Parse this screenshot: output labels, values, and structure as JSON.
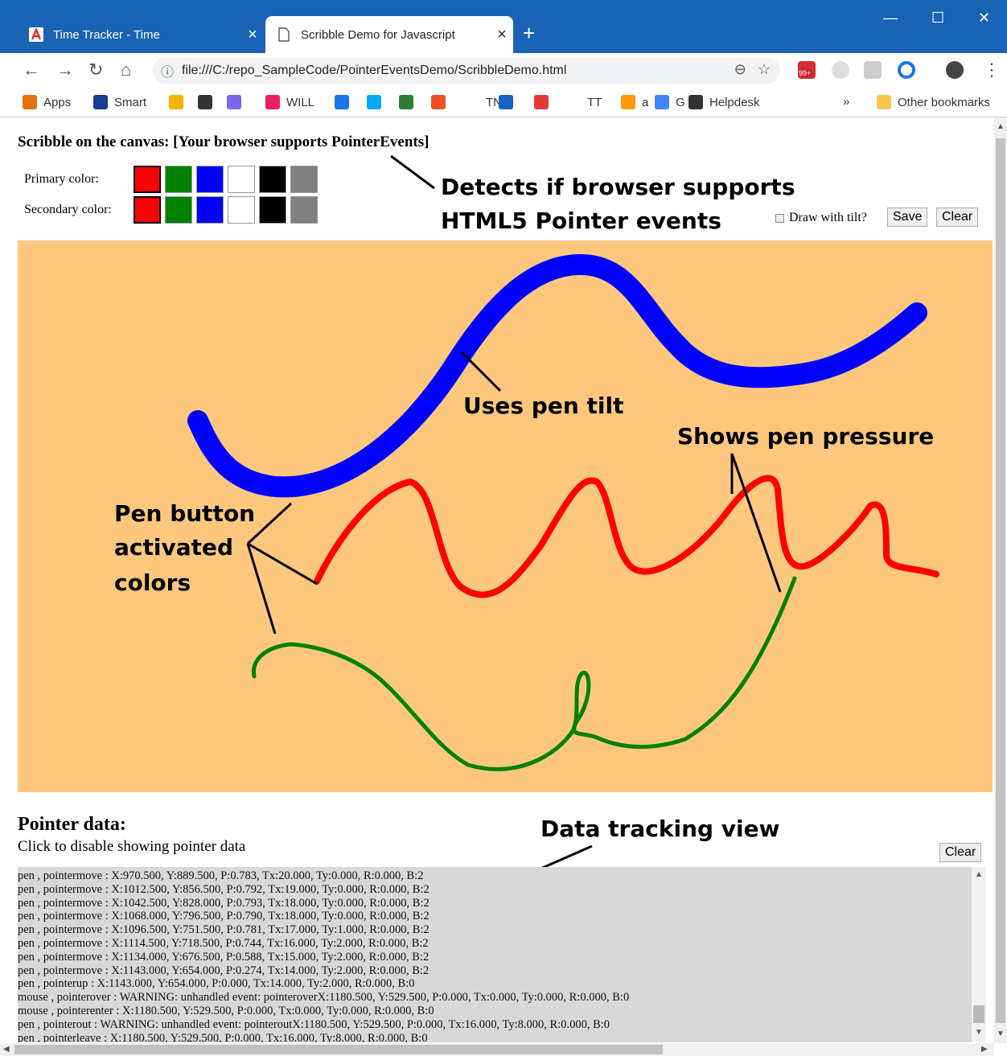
{
  "browser": {
    "tabs": [
      {
        "label": "Time Tracker - Time",
        "icon": "adobe-icon"
      },
      {
        "label": "Scribble Demo for Javascript",
        "icon": "document-icon"
      }
    ],
    "url": "file:///C:/repo_SampleCode/PointerEventsDemo/ScribbleDemo.html",
    "extension_badge": "99+",
    "bookmarks": [
      {
        "label": "Apps"
      },
      {
        "label": "Smart"
      },
      {
        "label": ""
      },
      {
        "label": ""
      },
      {
        "label": ""
      },
      {
        "label": "WILL"
      },
      {
        "label": ""
      },
      {
        "label": ""
      },
      {
        "label": ""
      },
      {
        "label": ""
      },
      {
        "label": "TN"
      },
      {
        "label": ""
      },
      {
        "label": ""
      },
      {
        "label": "TT"
      },
      {
        "label": "a"
      },
      {
        "label": "G"
      },
      {
        "label": "Helpdesk"
      }
    ],
    "overflow_label": "»",
    "other_bookmarks": "Other bookmarks"
  },
  "page": {
    "heading": "Scribble on the canvas: [Your browser supports PointerEvents]",
    "primary_label": "Primary color:",
    "secondary_label": "Secondary color:",
    "swatches": [
      "#ff0000",
      "#008000",
      "#0000ff",
      "#ffffff",
      "#000000",
      "#808080"
    ],
    "tilt_label": "Draw with tilt?",
    "save_label": "Save",
    "clear_label": "Clear",
    "annotations": {
      "detects_line1": "Detects if browser supports",
      "detects_line2": "HTML5 Pointer events",
      "tilt": "Uses pen tilt",
      "pressure": "Shows pen pressure",
      "button_line1": "Pen button",
      "button_line2": "activated",
      "button_line3": "colors",
      "tracking": "Data tracking view"
    },
    "pointer_data_title": "Pointer data:",
    "pointer_data_sub": "Click to disable showing pointer data",
    "log_clear_label": "Clear",
    "log_lines": [
      "pen , pointermove : X:970.500, Y:889.500, P:0.783, Tx:20.000, Ty:0.000, R:0.000, B:2",
      "pen , pointermove : X:1012.500, Y:856.500, P:0.792, Tx:19.000, Ty:0.000, R:0.000, B:2",
      "pen , pointermove : X:1042.500, Y:828.000, P:0.793, Tx:18.000, Ty:0.000, R:0.000, B:2",
      "pen , pointermove : X:1068.000, Y:796.500, P:0.790, Tx:18.000, Ty:0.000, R:0.000, B:2",
      "pen , pointermove : X:1096.500, Y:751.500, P:0.781, Tx:17.000, Ty:1.000, R:0.000, B:2",
      "pen , pointermove : X:1114.500, Y:718.500, P:0.744, Tx:16.000, Ty:2.000, R:0.000, B:2",
      "pen , pointermove : X:1134.000, Y:676.500, P:0.588, Tx:15.000, Ty:2.000, R:0.000, B:2",
      "pen , pointermove : X:1143.000, Y:654.000, P:0.274, Tx:14.000, Ty:2.000, R:0.000, B:2",
      "pen , pointerup : X:1143.000, Y:654.000, P:0.000, Tx:14.000, Ty:2.000, R:0.000, B:0",
      "mouse , pointerover : WARNING: unhandled event: pointeroverX:1180.500, Y:529.500, P:0.000, Tx:0.000, Ty:0.000, R:0.000, B:0",
      "mouse , pointerenter : X:1180.500, Y:529.500, P:0.000, Tx:0.000, Ty:0.000, R:0.000, B:0",
      "pen , pointerout : WARNING: unhandled event: pointeroutX:1180.500, Y:529.500, P:0.000, Tx:16.000, Ty:8.000, R:0.000, B:0",
      "pen , pointerleave : X:1180.500, Y:529.500, P:0.000, Tx:16.000, Ty:8.000, R:0.000, B:0"
    ]
  }
}
